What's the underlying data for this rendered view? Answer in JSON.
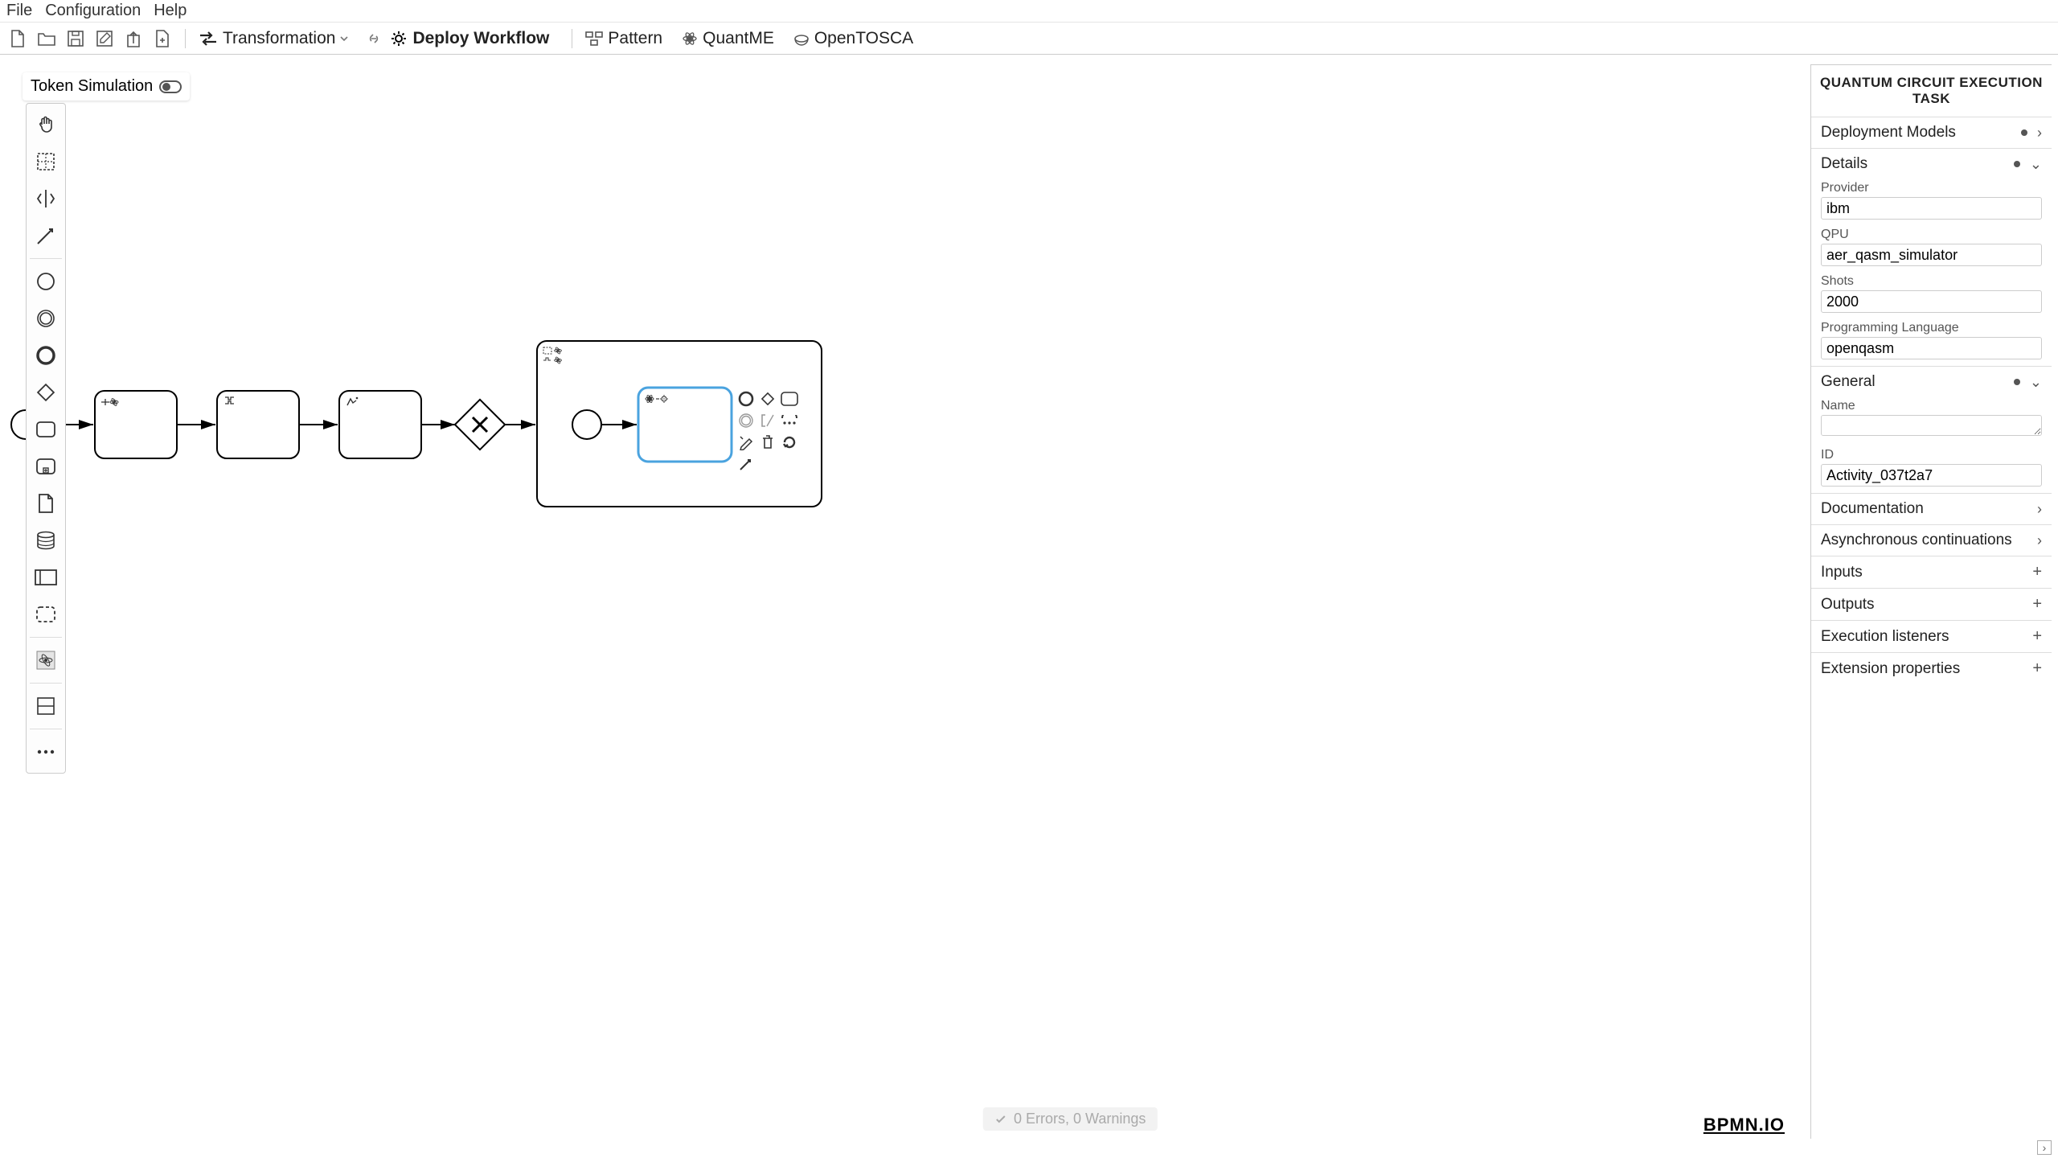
{
  "menubar": {
    "file": "File",
    "config": "Configuration",
    "help": "Help"
  },
  "toolbar": {
    "transformation": "Transformation",
    "deploy": "Deploy Workflow",
    "pattern": "Pattern",
    "quantme": "QuantME",
    "opentosca": "OpenTOSCA"
  },
  "token_sim": "Token Simulation",
  "status_text": "0 Errors, 0 Warnings",
  "logo": "BPMN.IO",
  "props": {
    "title": "QUANTUM CIRCUIT EXECUTION TASK",
    "sections": {
      "deployment_models": "Deployment Models",
      "details": "Details",
      "general": "General",
      "documentation": "Documentation",
      "async": "Asynchronous continuations",
      "inputs": "Inputs",
      "outputs": "Outputs",
      "exec_listeners": "Execution listeners",
      "ext_props": "Extension properties"
    },
    "fields": {
      "provider_label": "Provider",
      "provider_value": "ibm",
      "qpu_label": "QPU",
      "qpu_value": "aer_qasm_simulator",
      "shots_label": "Shots",
      "shots_value": "2000",
      "lang_label": "Programming Language",
      "lang_value": "openqasm",
      "name_label": "Name",
      "name_value": "",
      "id_label": "ID",
      "id_value": "Activity_037t2a7"
    }
  }
}
